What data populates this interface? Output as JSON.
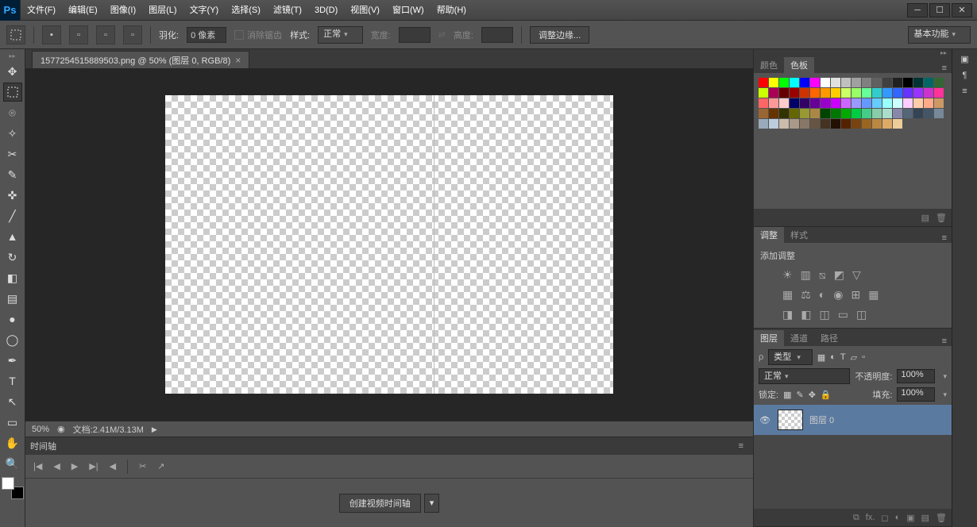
{
  "menu": {
    "file": "文件(F)",
    "edit": "编辑(E)",
    "image": "图像(I)",
    "layer": "图层(L)",
    "type": "文字(Y)",
    "select": "选择(S)",
    "filter": "滤镜(T)",
    "threed": "3D(D)",
    "view": "视图(V)",
    "window": "窗口(W)",
    "help": "帮助(H)"
  },
  "options": {
    "feather_label": "羽化:",
    "feather_value": "0 像素",
    "antialias": "消除锯齿",
    "style_label": "样式:",
    "style_value": "正常",
    "width_label": "宽度:",
    "height_label": "高度:",
    "refine": "调整边缘...",
    "workspace": "基本功能"
  },
  "document": {
    "tab_title": "1577254515889503.png @ 50% (图层 0, RGB/8)",
    "zoom": "50%",
    "size_label": "文档:2.41M/3.13M"
  },
  "timeline": {
    "title": "时间轴",
    "create": "创建视频时间轴"
  },
  "panels": {
    "color": "颜色",
    "swatches": "色板",
    "adjustments": "调整",
    "styles": "样式",
    "add_adjustment": "添加调整",
    "layers": "图层",
    "channels": "通道",
    "paths": "路径",
    "kind_label": "类型",
    "blend": "正常",
    "opacity_label": "不透明度:",
    "opacity": "100%",
    "lock_label": "锁定:",
    "fill_label": "填充:",
    "fill": "100%",
    "layer0": "图层 0"
  },
  "swatch_colors": [
    "#ff0000",
    "#ffff00",
    "#00ff00",
    "#00ffff",
    "#0000ff",
    "#ff00ff",
    "#ffffff",
    "#e0e0e0",
    "#c0c0c0",
    "#a0a0a0",
    "#808080",
    "#606060",
    "#404040",
    "#202020",
    "#000000",
    "#003333",
    "#006666",
    "#336633",
    "#ccff00",
    "#aa0055",
    "#660000",
    "#990000",
    "#cc3300",
    "#ff6600",
    "#ff9900",
    "#ffcc00",
    "#ccff66",
    "#99ff66",
    "#66ff99",
    "#33cccc",
    "#3399ff",
    "#3366ff",
    "#6633ff",
    "#9933ff",
    "#cc33cc",
    "#ff3399",
    "#ff6666",
    "#ff9999",
    "#ffcccc",
    "#000066",
    "#330066",
    "#660099",
    "#9900cc",
    "#cc00ff",
    "#cc66ff",
    "#9999ff",
    "#6699ff",
    "#66ccff",
    "#99ffff",
    "#ccffff",
    "#ffccff",
    "#ffccaa",
    "#ffaa88",
    "#cc9966",
    "#996633",
    "#663300",
    "#333300",
    "#666600",
    "#999933",
    "#aa8844",
    "#004400",
    "#007700",
    "#00aa00",
    "#00cc44",
    "#44cc88",
    "#88ccaa",
    "#aaddcc",
    "#8888aa",
    "#556677",
    "#334455",
    "#445566",
    "#778899",
    "#99aabb",
    "#bbccdd",
    "#ccbbaa",
    "#aa9988",
    "#887766",
    "#665544",
    "#443322",
    "#221100",
    "#552200",
    "#774411",
    "#996622",
    "#bb8844",
    "#ddaa66",
    "#eecc99"
  ]
}
